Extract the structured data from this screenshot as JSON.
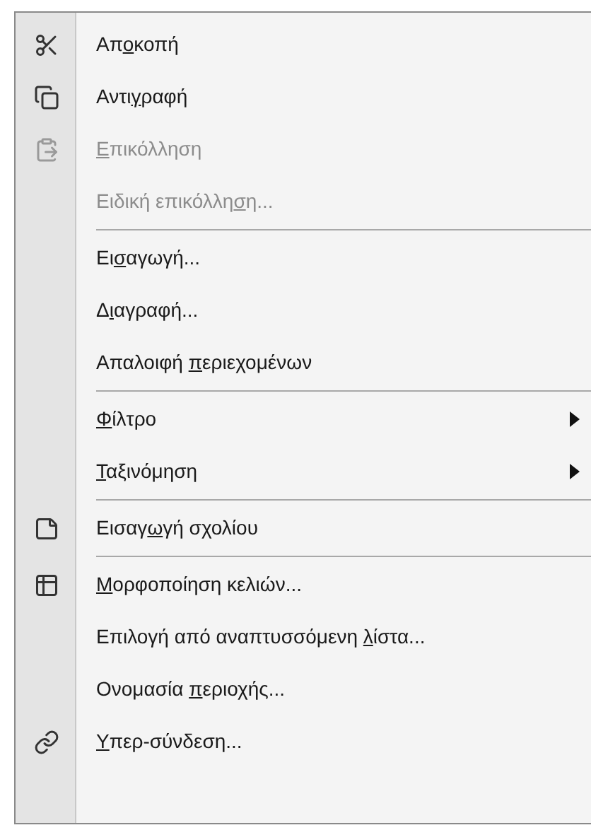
{
  "menu": {
    "items": [
      {
        "kind": "command",
        "label_start": "Απ",
        "access_key": "ο",
        "label_end": "κοπή",
        "disabled": false
      },
      {
        "kind": "command",
        "label_start": "Αντι",
        "access_key": "γ",
        "label_end": "ραφή",
        "disabled": false
      },
      {
        "kind": "command",
        "access_key": "Ε",
        "label_end": "πικόλληση",
        "disabled": true
      },
      {
        "kind": "command",
        "label_start": "Ειδική επικόλλη",
        "access_key": "σ",
        "label_end": "η...",
        "disabled": true
      },
      {
        "kind": "separator"
      },
      {
        "kind": "command",
        "label_start": "Ει",
        "access_key": "σ",
        "label_end": "αγωγή...",
        "disabled": false
      },
      {
        "kind": "command",
        "label_start": "Δ",
        "access_key": "ι",
        "label_end": "αγραφή...",
        "disabled": false
      },
      {
        "kind": "command",
        "label_start": "Απαλοιφή ",
        "access_key": "π",
        "label_end": "εριεχομένων",
        "disabled": false
      },
      {
        "kind": "separator"
      },
      {
        "kind": "submenu",
        "access_key": "Φ",
        "label_end": "ίλτρο",
        "disabled": false
      },
      {
        "kind": "submenu",
        "access_key": "Τ",
        "label_end": "αξινόμηση",
        "disabled": false
      },
      {
        "kind": "separator"
      },
      {
        "kind": "command",
        "label_start": "Εισαγ",
        "access_key": "ω",
        "label_end": "γή σχολίου",
        "disabled": false
      },
      {
        "kind": "separator"
      },
      {
        "kind": "command",
        "access_key": "Μ",
        "label_end": "ορφοποίηση κελιών...",
        "disabled": false
      },
      {
        "kind": "command",
        "label_start": "Επιλογή από αναπτυσσόμενη ",
        "access_key": "λ",
        "label_end": "ίστα...",
        "disabled": false
      },
      {
        "kind": "command",
        "label_start": "Ονομασία ",
        "access_key": "π",
        "label_end": "εριοχής...",
        "disabled": false
      },
      {
        "kind": "command",
        "access_key": "Υ",
        "label_end": "περ-σύνδεση...",
        "disabled": false
      }
    ]
  }
}
